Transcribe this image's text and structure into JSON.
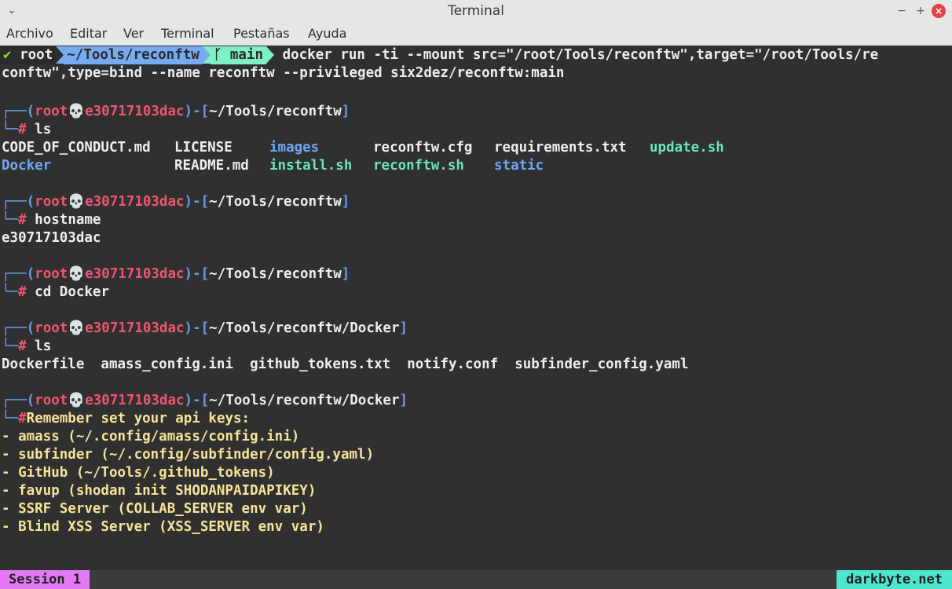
{
  "window": {
    "title": "Terminal",
    "controls": {
      "minimize": "−",
      "maximize": "+",
      "close": "×"
    }
  },
  "menu": [
    "Archivo",
    "Editar",
    "Ver",
    "Terminal",
    "Pestañas",
    "Ayuda"
  ],
  "prompt_bar": {
    "check": "✔",
    "user": "root",
    "path": "~/Tools/reconftw",
    "branch_icon": "ᚴ",
    "branch": "main",
    "command_line1": "docker run -ti --mount src=\"/root/Tools/reconftw\",target=\"/root/Tools/re",
    "command_line2": "conftw\",type=bind --name reconftw --privileged six2dez/reconftw:main"
  },
  "prompt": {
    "corner_top": "┌──",
    "corner_bottom": "└─",
    "open": "(",
    "user": "root",
    "skull": "💀",
    "host": "e30717103dac",
    "close_dash": ")-[",
    "close": "]",
    "hash": "#"
  },
  "blocks": [
    {
      "path": "~/Tools/reconftw",
      "command": "ls"
    },
    {
      "path": "~/Tools/reconftw",
      "command": "hostname"
    },
    {
      "path": "~/Tools/reconftw",
      "command": "cd Docker"
    },
    {
      "path": "~/Tools/reconftw/Docker",
      "command": "ls"
    },
    {
      "path": "~/Tools/reconftw/Docker",
      "command": "Remember set your api keys:"
    }
  ],
  "ls1": {
    "row1": [
      "CODE_OF_CONDUCT.md",
      "LICENSE",
      "images",
      "reconftw.cfg",
      "requirements.txt",
      "update.sh"
    ],
    "row2": [
      "Docker",
      "README.md",
      "install.sh",
      "reconftw.sh",
      "static"
    ]
  },
  "hostname_output": "e30717103dac",
  "ls2": "Dockerfile  amass_config.ini  github_tokens.txt  notify.conf  subfinder_config.yaml",
  "api_keys": [
    "- amass (~/.config/amass/config.ini)",
    "- subfinder (~/.config/subfinder/config.yaml)",
    "- GitHub (~/Tools/.github_tokens)",
    "- favup (shodan init SHODANPAIDAPIKEY)",
    "- SSRF Server (COLLAB_SERVER env var)",
    "- Blind XSS Server (XSS_SERVER env var)"
  ],
  "status": {
    "session": "Session 1",
    "brand": "darkbyte.net"
  },
  "colors": {
    "prompt_user": "#ef5572",
    "prompt_bracket": "#6b9cf0",
    "directory": "#6ea7f5",
    "executable": "#6ae6b3",
    "message": "#f5e49a",
    "session_bg": "#e479f5",
    "brand_bg": "#4fe6d0"
  }
}
